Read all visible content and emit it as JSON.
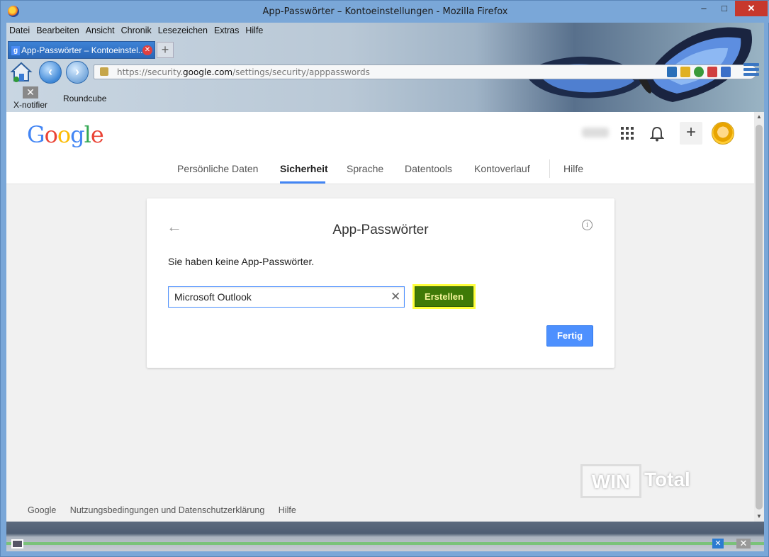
{
  "window": {
    "title": "App-Passwörter – Kontoeinstellungen - Mozilla Firefox",
    "minimize": "–",
    "maximize": "□",
    "close": "✕"
  },
  "menubar": {
    "items": [
      {
        "label": "Datei"
      },
      {
        "label": "Bearbeiten"
      },
      {
        "label": "Ansicht"
      },
      {
        "label": "Chronik"
      },
      {
        "label": "Lesezeichen"
      },
      {
        "label": "Extras"
      },
      {
        "label": "Hilfe"
      }
    ]
  },
  "tabs": {
    "active_label": "App-Passwörter – Kontoeinstel...",
    "favicon": "g",
    "new_tab": "+"
  },
  "addressbar": {
    "url_prefix": "https://security.",
    "url_domain": "google.com",
    "url_suffix": "/settings/security/apppasswords"
  },
  "bookmarks": {
    "xnotifier": "X-notifier",
    "roundcube": "Roundcube"
  },
  "google": {
    "logo": [
      "G",
      "o",
      "o",
      "g",
      "l",
      "e"
    ],
    "nav": {
      "personal": "Persönliche Daten",
      "security": "Sicherheit",
      "language": "Sprache",
      "datatools": "Datentools",
      "history": "Kontoverlauf",
      "help": "Hilfe"
    },
    "plus": "+"
  },
  "card": {
    "back": "←",
    "info": "i",
    "title": "App-Passwörter",
    "message": "Sie haben keine App-Passwörter.",
    "input_value": "Microsoft Outlook",
    "clear": "✕",
    "create_label": "Erstellen",
    "done_label": "Fertig"
  },
  "footer": {
    "google": "Google",
    "terms": "Nutzungsbedingungen und Datenschutzerklärung",
    "help": "Hilfe"
  },
  "watermark": {
    "part1": "WIN",
    "part2": "Total"
  },
  "icons": {
    "home": "home-icon",
    "back": "back-icon",
    "forward": "forward-icon",
    "lock": "lock-icon",
    "apps": "apps-grid-icon",
    "bell": "bell-icon",
    "menu": "hamburger-icon"
  },
  "colors": {
    "accent": "#4285f4",
    "create_button": "#3f7a07",
    "create_highlight": "#ffff3a",
    "done_button": "#4d90fe"
  }
}
